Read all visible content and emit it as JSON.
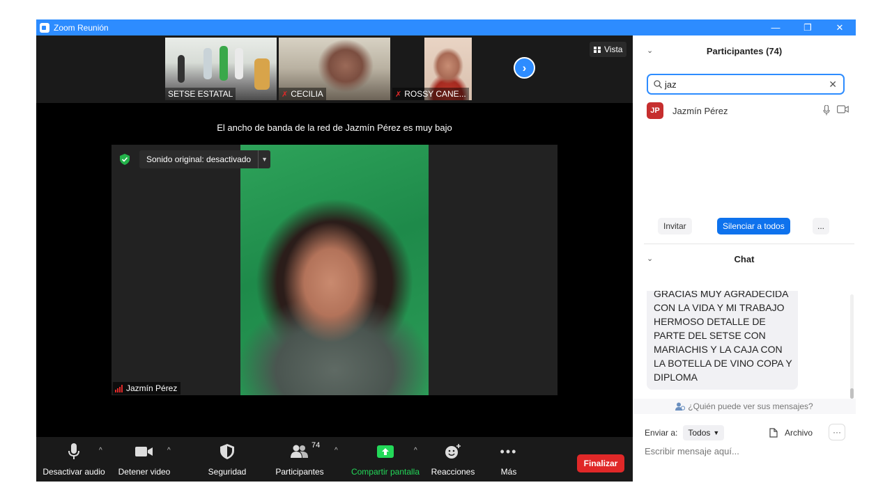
{
  "window": {
    "title": "Zoom Reunión",
    "controls": [
      "—",
      "❐",
      "✕"
    ]
  },
  "stage": {
    "view_button": "Vista",
    "thumbnails": [
      {
        "name": "SETSE ESTATAL",
        "muted": false
      },
      {
        "name": "CECILIA",
        "muted": true
      },
      {
        "name": "ROSSY CANE...",
        "muted": true
      }
    ],
    "bandwidth_warning": "El ancho de banda de la red de Jazmín Pérez es muy bajo",
    "original_sound": "Sonido original: desactivado",
    "active_speaker": "Jazmín Pérez"
  },
  "toolbar": {
    "items": [
      {
        "label": "Desactivar audio",
        "icon": "microphone-icon"
      },
      {
        "label": "Detener video",
        "icon": "video-camera-icon"
      },
      {
        "label": "Seguridad",
        "icon": "shield-icon"
      },
      {
        "label": "Participantes",
        "icon": "participants-icon",
        "count": "74"
      },
      {
        "label": "Compartir pantalla",
        "icon": "share-screen-icon"
      },
      {
        "label": "Reacciones",
        "icon": "reactions-icon"
      },
      {
        "label": "Más",
        "icon": "more-dots-icon"
      }
    ],
    "end_button": "Finalizar"
  },
  "participants": {
    "header": "Participantes (74)",
    "search_value": "jaz",
    "list": [
      {
        "initials": "JP",
        "name": "Jazmín Pérez"
      }
    ],
    "invite": "Invitar",
    "mute_all": "Silenciar a todos",
    "more": "..."
  },
  "chat": {
    "header": "Chat",
    "message_lines": [
      "GRACIAS MUY AGRADECIDA",
      "CON LA VIDA Y MI TRABAJO",
      "HERMOSO DETALLE DE",
      "PARTE DEL SETSE CON",
      "MARIACHIS Y LA CAJA CON",
      "LA BOTELLA DE VINO COPA Y",
      "DIPLOMA"
    ],
    "who_can_see": "¿Quién puede ver sus mensajes?",
    "send_to_label": "Enviar a:",
    "send_to_value": "Todos",
    "file_button": "Archivo",
    "compose_placeholder": "Escribir mensaje aquí..."
  },
  "colors": {
    "zoom_blue": "#2d8cff",
    "end_red": "#e02828",
    "share_green": "#23d959",
    "avatar_red": "#c62e2e"
  }
}
